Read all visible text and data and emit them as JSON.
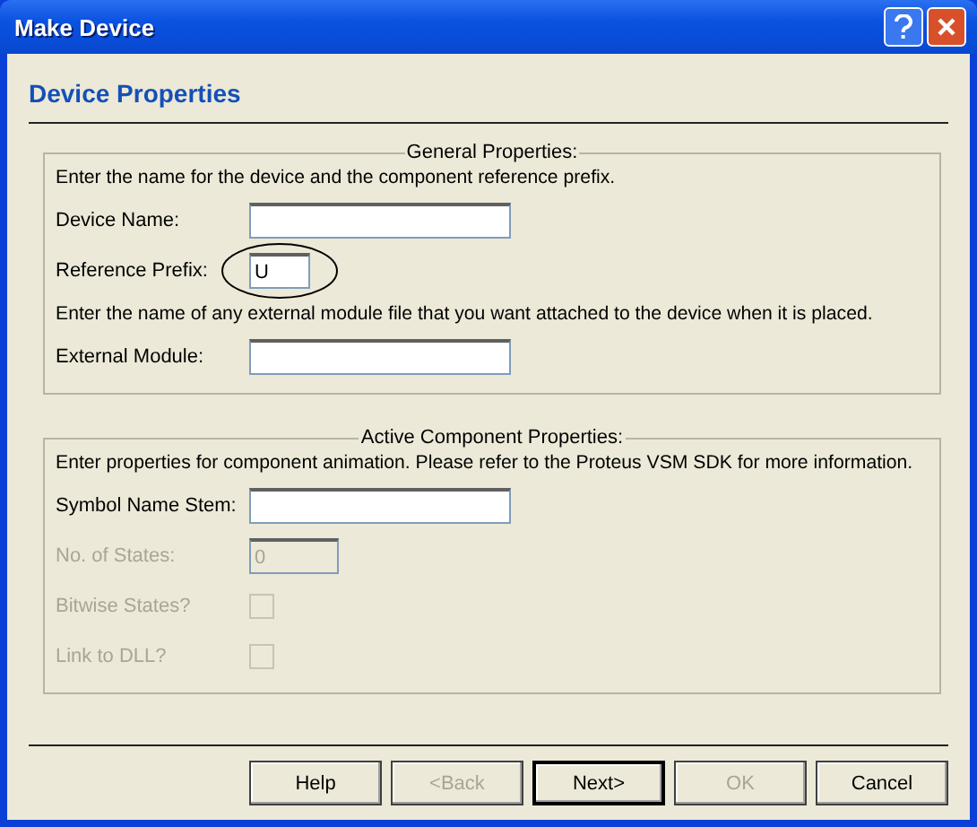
{
  "window": {
    "title": "Make Device"
  },
  "header": "Device Properties",
  "groups": [
    {
      "title": "General Properties:",
      "rows": [
        {
          "kind": "note",
          "text": "Enter the name for the device and the component reference prefix."
        },
        {
          "kind": "text",
          "label": "Device Name:",
          "value": "",
          "disabled": false
        },
        {
          "kind": "short",
          "label": "Reference Prefix:",
          "value": "U",
          "disabled": false,
          "circled": true
        },
        {
          "kind": "note",
          "text": "Enter the name of any external module file that you want attached to the device when it is placed."
        },
        {
          "kind": "text",
          "label": "External Module:",
          "value": "",
          "disabled": false
        }
      ]
    },
    {
      "title": "Active Component Properties:",
      "rows": [
        {
          "kind": "note",
          "text": "Enter properties for component animation. Please refer to the Proteus VSM SDK for more information."
        },
        {
          "kind": "text",
          "label": "Symbol Name Stem:",
          "value": "",
          "disabled": false
        },
        {
          "kind": "short",
          "label": "No. of States:",
          "value": "0",
          "disabled": true
        },
        {
          "kind": "checkbox",
          "label": "Bitwise States?",
          "checked": false,
          "disabled": true
        },
        {
          "kind": "checkbox",
          "label": "Link to DLL?",
          "checked": false,
          "disabled": true
        }
      ]
    }
  ],
  "buttons": [
    {
      "label": "Help",
      "disabled": false,
      "default": false
    },
    {
      "label": "<Back",
      "disabled": true,
      "default": false
    },
    {
      "label": "Next>",
      "disabled": false,
      "default": true
    },
    {
      "label": "OK",
      "disabled": true,
      "default": false
    },
    {
      "label": "Cancel",
      "disabled": false,
      "default": false
    }
  ]
}
